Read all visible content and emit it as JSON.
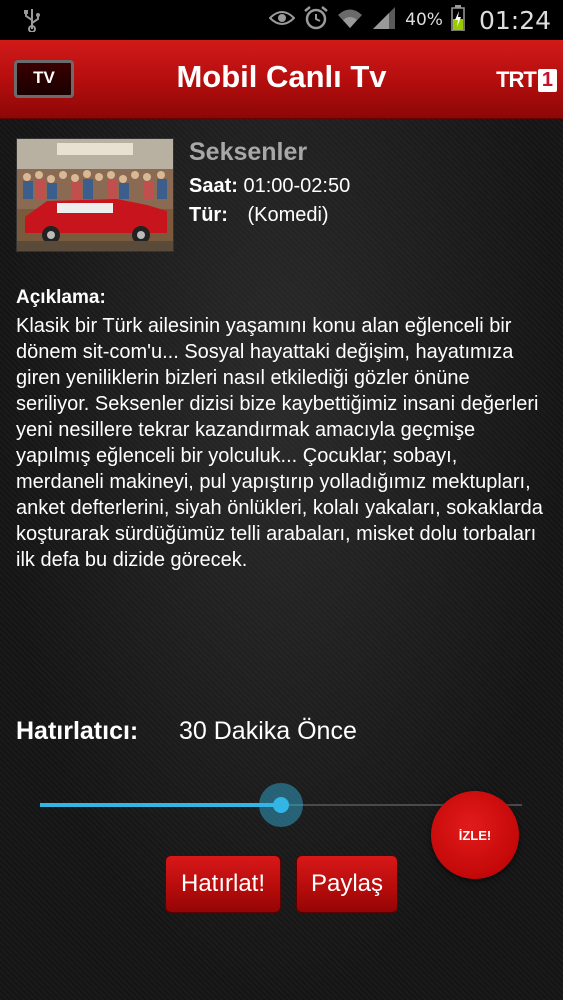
{
  "status_bar": {
    "battery_percent": "40%",
    "time": "01:24"
  },
  "action_bar": {
    "title": "Mobil Canlı Tv",
    "tv_logo_text": "TV",
    "channel_logo_text": "TRT",
    "channel_logo_number": "1"
  },
  "program": {
    "title": "Seksenler",
    "time_label": "Saat:",
    "time_value": "01:00-02:50",
    "genre_label": "Tür:",
    "genre_value": "(Komedi)"
  },
  "description": {
    "label": "Açıklama:",
    "text": "Klasik bir Türk ailesinin yaşamını konu alan eğlenceli bir dönem sit-com'u... Sosyal hayattaki değişim, hayatımıza giren yeniliklerin bizleri nasıl etkilediği gözler önüne seriliyor. Seksenler dizisi bize kaybettiğimiz insani değerleri yeni nesillere tekrar kazandırmak amacıyla geçmişe yapılmış eğlenceli bir yolculuk... Çocuklar; sobayı, merdaneli makineyi, pul yapıştırıp yolladığımız mektupları, anket defterlerini, siyah önlükleri, kolalı yakaları, sokaklarda koşturarak sürdüğümüz telli arabaları, misket dolu torbaları ilk defa bu dizide görecek."
  },
  "reminder": {
    "label": "Hatırlatıcı:",
    "value": "30 Dakika Önce",
    "slider_fraction": 0.5
  },
  "buttons": {
    "watch": "İZLE!",
    "remind": "Hatırlat!",
    "share": "Paylaş"
  },
  "colors": {
    "accent_red": "#c40808",
    "slider_blue": "#33b5e5"
  }
}
